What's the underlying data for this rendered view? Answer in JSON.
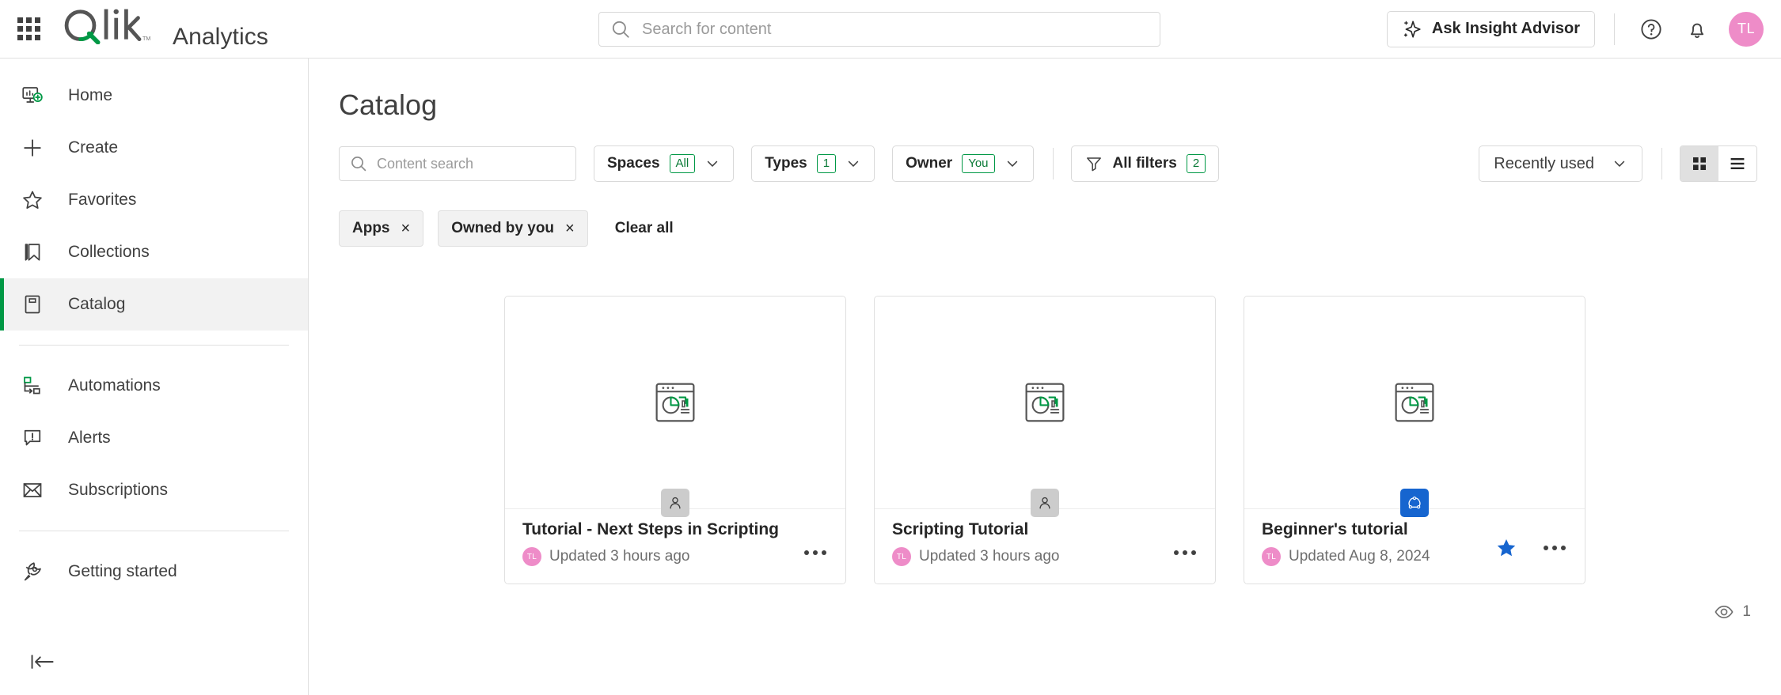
{
  "header": {
    "launcher_label": "app-launcher",
    "brand": "Analytics",
    "logo_text": "Qlik",
    "search": {
      "placeholder": "Search for content",
      "value": ""
    },
    "insight_advisor": "Ask Insight Advisor",
    "help_icon": "help-circle-icon",
    "notifications_icon": "bell-icon",
    "avatar_initials": "TL"
  },
  "sidebar": {
    "items": [
      {
        "label": "Home",
        "icon": "home-monitor-add-icon",
        "active": false
      },
      {
        "label": "Create",
        "icon": "plus-icon",
        "active": false
      },
      {
        "label": "Favorites",
        "icon": "star-outline-icon",
        "active": false
      },
      {
        "label": "Collections",
        "icon": "bookmark-icon",
        "active": false
      },
      {
        "label": "Catalog",
        "icon": "book-icon",
        "active": true
      },
      {
        "label": "Automations",
        "icon": "automation-flow-icon",
        "active": false
      },
      {
        "label": "Alerts",
        "icon": "alert-bubble-icon",
        "active": false
      },
      {
        "label": "Subscriptions",
        "icon": "envelope-icon",
        "active": false
      },
      {
        "label": "Getting started",
        "icon": "rocket-icon",
        "active": false
      }
    ],
    "collapse_icon": "collapse-left-icon"
  },
  "main": {
    "title": "Catalog",
    "toolbar": {
      "content_search_placeholder": "Content search",
      "content_search_value": "",
      "filters": [
        {
          "label": "Spaces",
          "badge": "All"
        },
        {
          "label": "Types",
          "badge": "1"
        },
        {
          "label": "Owner",
          "badge": "You"
        }
      ],
      "all_filters": {
        "label": "All filters",
        "badge": "2",
        "icon": "funnel-icon"
      },
      "sort": {
        "label": "Recently used",
        "icon": "chevron-down-icon"
      },
      "view_grid": {
        "name": "grid-view",
        "active": true
      },
      "view_list": {
        "name": "list-view",
        "active": false
      }
    },
    "chips": [
      {
        "label": "Apps",
        "remove": "×"
      },
      {
        "label": "Owned by you",
        "remove": "×"
      }
    ],
    "clear_all": "Clear all",
    "cards": [
      {
        "title": "Tutorial - Next Steps in Scripting",
        "owner_initials": "TL",
        "meta": "Updated 3 hours ago",
        "space": "personal",
        "space_icon": "person-icon",
        "favorite": false,
        "thumb_icon": "app-chart-icon"
      },
      {
        "title": "Scripting Tutorial",
        "owner_initials": "TL",
        "meta": "Updated 3 hours ago",
        "space": "personal",
        "space_icon": "person-icon",
        "favorite": false,
        "thumb_icon": "app-chart-icon"
      },
      {
        "title": "Beginner's tutorial",
        "owner_initials": "TL",
        "meta": "Updated Aug 8, 2024",
        "space": "shared",
        "space_icon": "shared-space-icon",
        "favorite": true,
        "thumb_icon": "app-chart-icon"
      }
    ],
    "footer": {
      "views_icon": "eye-icon",
      "views_count": "1"
    }
  },
  "colors": {
    "accent_green": "#009845",
    "avatar_pink": "#ee8cc8",
    "shared_blue": "#1665cf",
    "star_blue": "#1665cf",
    "text": "#404040"
  }
}
